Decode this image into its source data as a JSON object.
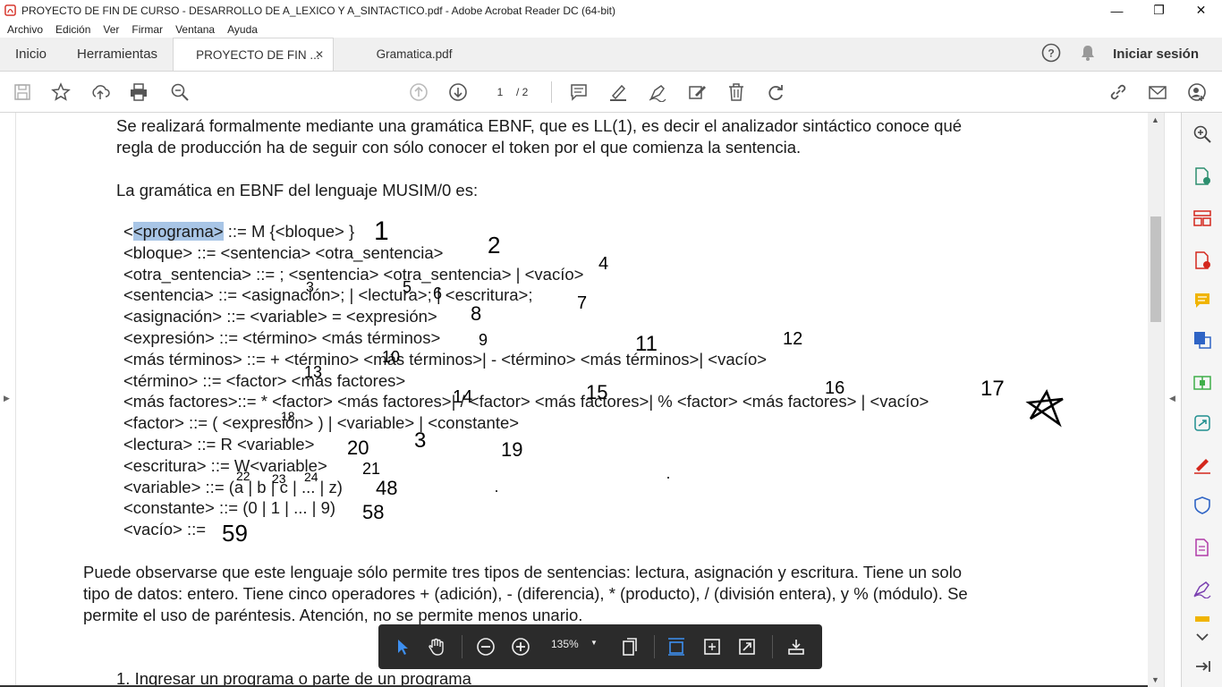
{
  "window": {
    "title": "PROYECTO DE FIN DE CURSO - DESARROLLO DE A_LEXICO Y A_SINTACTICO.pdf - Adobe Acrobat Reader DC (64-bit)",
    "minimize_icon": "minimize-icon",
    "maximize_icon": "restore-icon",
    "close_icon": "close-icon"
  },
  "menu": [
    "Archivo",
    "Edición",
    "Ver",
    "Firmar",
    "Ventana",
    "Ayuda"
  ],
  "tabs": {
    "home": "Inicio",
    "tools": "Herramientas",
    "doc1": "PROYECTO DE FIN ...",
    "doc2": "Gramatica.pdf",
    "signin": "Iniciar sesión"
  },
  "toolbar": {
    "page_current": "1",
    "page_total": "/ 2"
  },
  "document": {
    "intro_line1": "Se realizará formalmente mediante una gramática EBNF, que es LL(1), es decir el analizador sintáctico conoce qué",
    "intro_line2": "regla de producción ha de seguir con sólo conocer el token por el que comienza la sentencia.",
    "grammar_heading": "La gramática en EBNF del lenguaje MUSIM/0 es:",
    "grammar": {
      "r1_sel": "<programa>",
      "r1_open": "<",
      "r1_rest": " ::= M {<bloque> }",
      "r2": "<bloque> ::= <sentencia> <otra_sentencia>",
      "r3": "<otra_sentencia> ::= ; <sentencia> <otra_sentencia> | <vacío>",
      "r4": "<sentencia> ::= <asignación>; | <lectura>; | <escritura>;",
      "r5": "<asignación> ::= <variable> = <expresión>",
      "r6": "<expresión> ::= <término> <más términos>",
      "r7": "<más términos> ::= + <término> <más términos>| - <término> <más términos>| <vacío>",
      "r8": "<término> ::= <factor> <más factores>",
      "r9": "<más factores>::= * <factor> <más factores>| / <factor> <más factores>| % <factor> <más factores> | <vacío>",
      "r10": "<factor> ::= ( <expresión> ) | <variable> | <constante>",
      "r11": "<lectura> ::= R <variable>",
      "r12": "<escritura> ::= W<variable>",
      "r13": "<variable> ::= (a | b | c | ... | z)",
      "r14": "<constante> ::= (0 | 1 | ... | 9)",
      "r15": "<vacío> ::="
    },
    "para_line1": "Puede observarse que este lenguaje sólo permite tres tipos de sentencias: lectura, asignación y escritura. Tiene un solo",
    "para_line2": "tipo de datos: entero. Tiene cinco operadores + (adición), - (diferencia), * (producto), / (división entera), y % (módulo). Se",
    "para_line3": "permite el uso de paréntesis. Atención, no se permite menos unario.",
    "list_item": "1.    Ingresar un programa o parte de un programa"
  },
  "handwritten": [
    "1",
    "2",
    "3",
    "4",
    "5",
    "6",
    "7",
    "8",
    "9",
    "10",
    "11",
    "12",
    "13",
    "14",
    "15",
    "16",
    "17",
    "18",
    "19",
    "20",
    "21",
    "22",
    "23",
    "24",
    "48",
    "58",
    "59"
  ],
  "float_toolbar": {
    "zoom": "135%"
  },
  "colors": {
    "selection": "#a8c5e6",
    "float_bar": "#2b2b2b",
    "acrobat_red": "#d4271d"
  }
}
